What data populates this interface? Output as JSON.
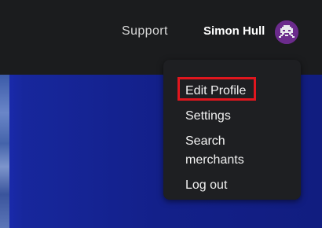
{
  "header": {
    "support_label": "Support",
    "user_name": "Simon Hull",
    "avatar_icon": "space-invader-avatar-icon",
    "avatar_color": "#6b2b8c"
  },
  "user_menu": {
    "items": [
      {
        "label": "Edit Profile",
        "highlighted": true
      },
      {
        "label": "Settings"
      },
      {
        "label": "Search merchants",
        "lines": [
          "Search",
          "merchants"
        ]
      },
      {
        "label": "Log out"
      }
    ],
    "highlight_color": "#e0161e"
  },
  "hero": {
    "color": "#13208a"
  }
}
